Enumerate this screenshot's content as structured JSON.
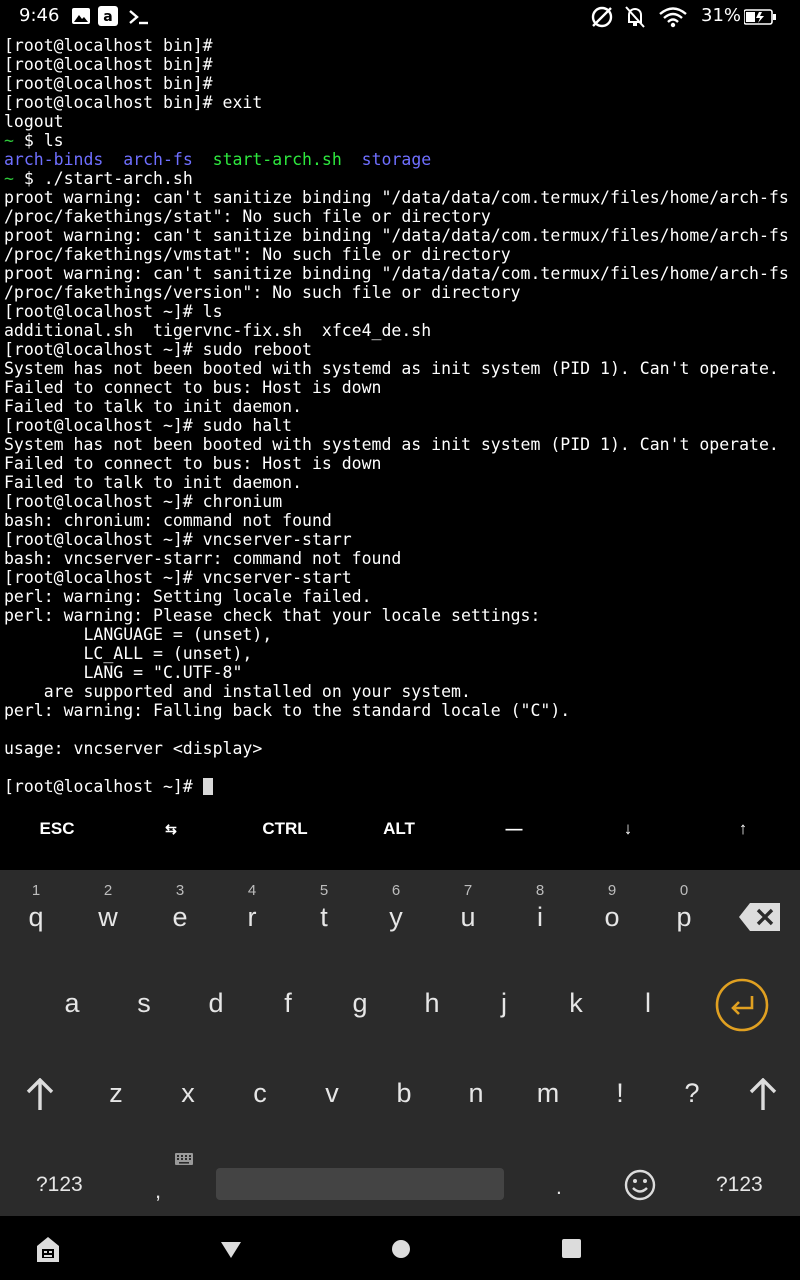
{
  "status_bar": {
    "time": "9:46",
    "battery": "31%",
    "left_icons": [
      "image-icon",
      "amazon-icon",
      "terminal-icon"
    ],
    "right_icons": [
      "sync-off-icon",
      "notifications-off-icon",
      "wifi-icon",
      "battery-charging-icon"
    ]
  },
  "terminal": {
    "lines": [
      [
        {
          "t": "[root@localhost bin]#",
          "c": "#ffffff"
        }
      ],
      [
        {
          "t": "[root@localhost bin]#",
          "c": "#ffffff"
        }
      ],
      [
        {
          "t": "[root@localhost bin]#",
          "c": "#ffffff"
        }
      ],
      [
        {
          "t": "[root@localhost bin]# exit",
          "c": "#ffffff"
        }
      ],
      [
        {
          "t": "logout",
          "c": "#ffffff"
        }
      ],
      [
        {
          "t": "~",
          "c": "#2ec93b"
        },
        {
          "t": " $ ls",
          "c": "#ffffff"
        }
      ],
      [
        {
          "t": "arch-binds",
          "c": "#6f6fff"
        },
        {
          "t": "  ",
          "c": "#ffffff"
        },
        {
          "t": "arch-fs",
          "c": "#6f6fff"
        },
        {
          "t": "  ",
          "c": "#ffffff"
        },
        {
          "t": "start-arch.sh",
          "c": "#2ee83e"
        },
        {
          "t": "  ",
          "c": "#ffffff"
        },
        {
          "t": "storage",
          "c": "#6f6fff"
        }
      ],
      [
        {
          "t": "~",
          "c": "#2ec93b"
        },
        {
          "t": " $ ./start-arch.sh",
          "c": "#ffffff"
        }
      ],
      [
        {
          "t": "proot warning: can't sanitize binding \"/data/data/com.termux/files/home/arch-fs",
          "c": "#ffffff"
        }
      ],
      [
        {
          "t": "/proc/fakethings/stat\": No such file or directory",
          "c": "#ffffff"
        }
      ],
      [
        {
          "t": "proot warning: can't sanitize binding \"/data/data/com.termux/files/home/arch-fs",
          "c": "#ffffff"
        }
      ],
      [
        {
          "t": "/proc/fakethings/vmstat\": No such file or directory",
          "c": "#ffffff"
        }
      ],
      [
        {
          "t": "proot warning: can't sanitize binding \"/data/data/com.termux/files/home/arch-fs",
          "c": "#ffffff"
        }
      ],
      [
        {
          "t": "/proc/fakethings/version\": No such file or directory",
          "c": "#ffffff"
        }
      ],
      [
        {
          "t": "[root@localhost ~]# ls",
          "c": "#ffffff"
        }
      ],
      [
        {
          "t": "additional.sh  tigervnc-fix.sh  xfce4_de.sh",
          "c": "#ffffff"
        }
      ],
      [
        {
          "t": "[root@localhost ~]# sudo reboot",
          "c": "#ffffff"
        }
      ],
      [
        {
          "t": "System has not been booted with systemd as init system (PID 1). Can't operate.",
          "c": "#ffffff"
        }
      ],
      [
        {
          "t": "Failed to connect to bus: Host is down",
          "c": "#ffffff"
        }
      ],
      [
        {
          "t": "Failed to talk to init daemon.",
          "c": "#ffffff"
        }
      ],
      [
        {
          "t": "[root@localhost ~]# sudo halt",
          "c": "#ffffff"
        }
      ],
      [
        {
          "t": "System has not been booted with systemd as init system (PID 1). Can't operate.",
          "c": "#ffffff"
        }
      ],
      [
        {
          "t": "Failed to connect to bus: Host is down",
          "c": "#ffffff"
        }
      ],
      [
        {
          "t": "Failed to talk to init daemon.",
          "c": "#ffffff"
        }
      ],
      [
        {
          "t": "[root@localhost ~]# chronium",
          "c": "#ffffff"
        }
      ],
      [
        {
          "t": "bash: chronium: command not found",
          "c": "#ffffff"
        }
      ],
      [
        {
          "t": "[root@localhost ~]# vncserver-starr",
          "c": "#ffffff"
        }
      ],
      [
        {
          "t": "bash: vncserver-starr: command not found",
          "c": "#ffffff"
        }
      ],
      [
        {
          "t": "[root@localhost ~]# vncserver-start",
          "c": "#ffffff"
        }
      ],
      [
        {
          "t": "perl: warning: Setting locale failed.",
          "c": "#ffffff"
        }
      ],
      [
        {
          "t": "perl: warning: Please check that your locale settings:",
          "c": "#ffffff"
        }
      ],
      [
        {
          "t": "        LANGUAGE = (unset),",
          "c": "#ffffff"
        }
      ],
      [
        {
          "t": "        LC_ALL = (unset),",
          "c": "#ffffff"
        }
      ],
      [
        {
          "t": "        LANG = \"C.UTF-8\"",
          "c": "#ffffff"
        }
      ],
      [
        {
          "t": "    are supported and installed on your system.",
          "c": "#ffffff"
        }
      ],
      [
        {
          "t": "perl: warning: Falling back to the standard locale (\"C\").",
          "c": "#ffffff"
        }
      ],
      [
        {
          "t": "",
          "c": "#ffffff"
        }
      ],
      [
        {
          "t": "usage: vncserver <display>",
          "c": "#ffffff"
        }
      ],
      [
        {
          "t": "",
          "c": "#ffffff"
        }
      ],
      [
        {
          "t": "[root@localhost ~]# ",
          "c": "#ffffff"
        }
      ]
    ]
  },
  "extra_keys": [
    "ESC",
    "⇆",
    "CTRL",
    "ALT",
    "—",
    "↓",
    "↑"
  ],
  "keyboard": {
    "row1": [
      {
        "key": "q",
        "hint": "1"
      },
      {
        "key": "w",
        "hint": "2"
      },
      {
        "key": "e",
        "hint": "3"
      },
      {
        "key": "r",
        "hint": "4"
      },
      {
        "key": "t",
        "hint": "5"
      },
      {
        "key": "y",
        "hint": "6"
      },
      {
        "key": "u",
        "hint": "7"
      },
      {
        "key": "i",
        "hint": "8"
      },
      {
        "key": "o",
        "hint": "9"
      },
      {
        "key": "p",
        "hint": "0"
      }
    ],
    "row2": [
      "a",
      "s",
      "d",
      "f",
      "g",
      "h",
      "j",
      "k",
      "l"
    ],
    "row3": [
      "z",
      "x",
      "c",
      "v",
      "b",
      "n",
      "m",
      "!",
      "?"
    ],
    "row4": {
      "symbols_left": "?123",
      "comma": ",",
      "period": ".",
      "symbols_right": "?123"
    },
    "accent_color": "#e0a021"
  },
  "nav_bar": [
    "back-icon",
    "home-icon",
    "recents-icon"
  ]
}
